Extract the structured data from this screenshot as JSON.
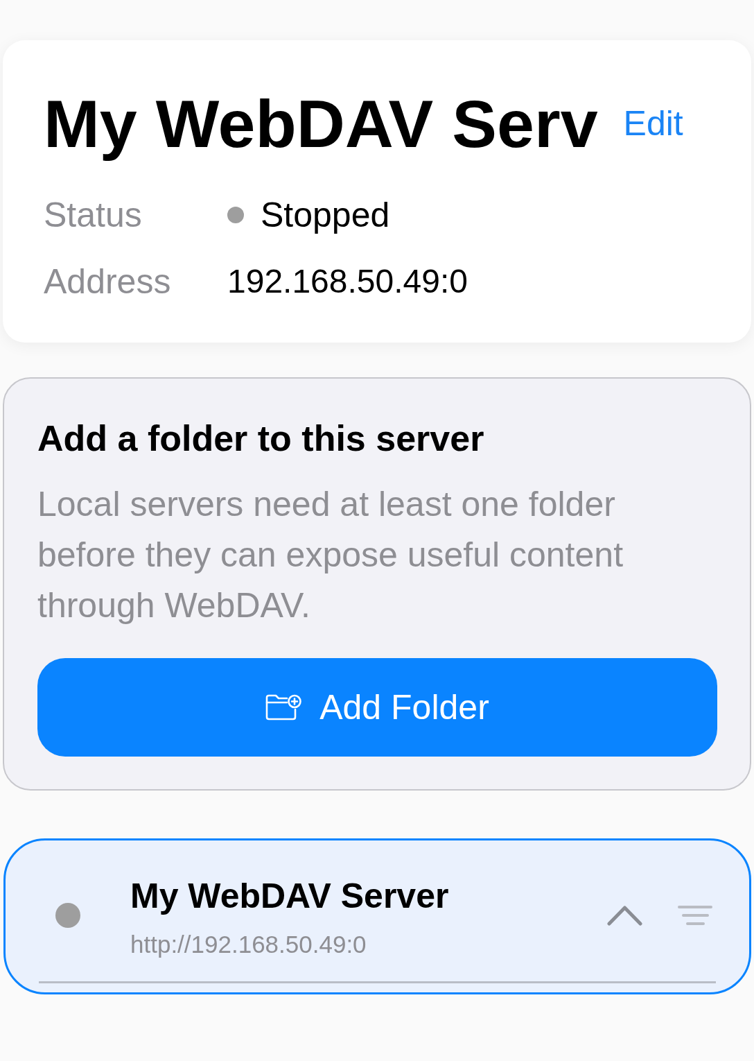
{
  "server_card": {
    "title": "My WebDAV Serv",
    "edit_link": "Edit",
    "fields": [
      {
        "kind": "status",
        "label": "Status",
        "value": "Stopped",
        "color": "#9e9e9e"
      },
      {
        "kind": "text",
        "label": "Address",
        "value": "192.168.50.49:0"
      }
    ]
  },
  "add_folder_card": {
    "heading": "Add a folder to this server",
    "description": "Local servers need at least one folder before they can expose useful content through WebDAV.",
    "button": "Add Folder"
  },
  "servers": [
    {
      "name": "My WebDAV Server",
      "url": "http://192.168.50.49:0",
      "color": "#9e9e9e",
      "selected": true,
      "expanded": true
    }
  ]
}
